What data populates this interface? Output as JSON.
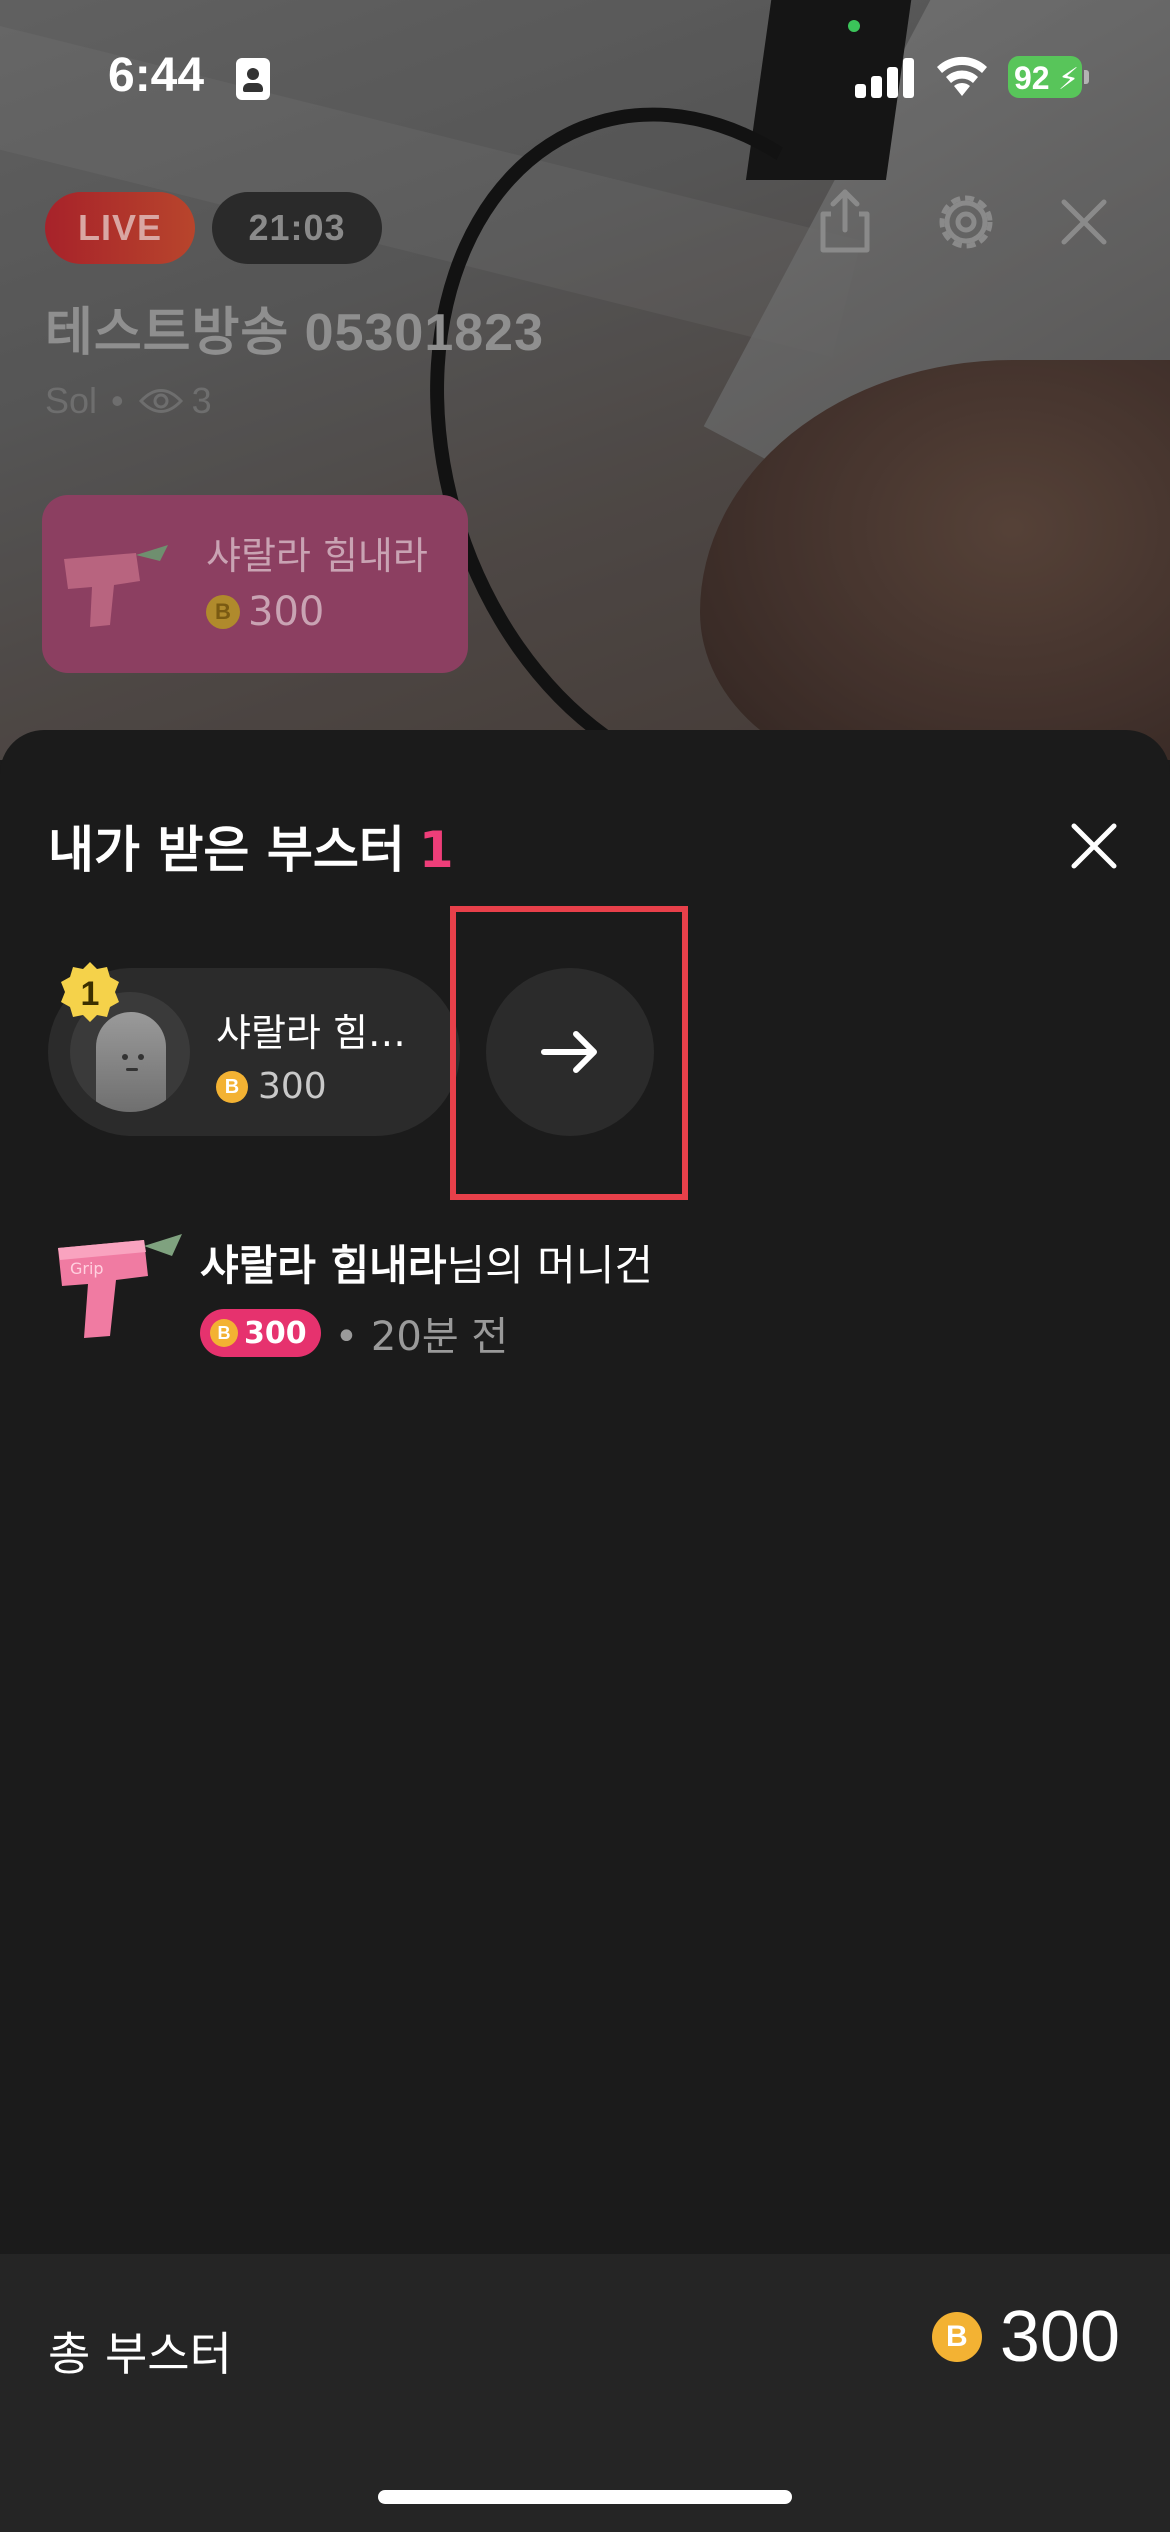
{
  "status_bar": {
    "time": "6:44",
    "battery_level": "92",
    "battery_color": "#58c55a"
  },
  "stream": {
    "live_label": "LIVE",
    "timer": "21:03",
    "title": "테스트방송 05301823",
    "host": "Sol",
    "separator": "•",
    "viewer_count": "3"
  },
  "gift_toast": {
    "sender": "샤랄라 힘내라",
    "coin_symbol": "B",
    "amount": "300"
  },
  "sheet": {
    "title": "내가 받은 부스터",
    "count": "1",
    "count_color": "#ee3e79",
    "top_booster": {
      "rank": "1",
      "name": "샤랄라 힘…",
      "coin_symbol": "B",
      "amount": "300"
    },
    "gift_list": [
      {
        "sender": "샤랄라 힘내라",
        "suffix": "님의 머니건",
        "coin_symbol": "B",
        "amount": "300",
        "time": "• 20분 전"
      }
    ]
  },
  "footer": {
    "label": "총 부스터",
    "coin_symbol": "B",
    "total": "300"
  },
  "icons": [
    "share-icon",
    "gear-icon",
    "close-icon",
    "eye-icon",
    "arrow-right-icon",
    "money-gun-icon"
  ]
}
